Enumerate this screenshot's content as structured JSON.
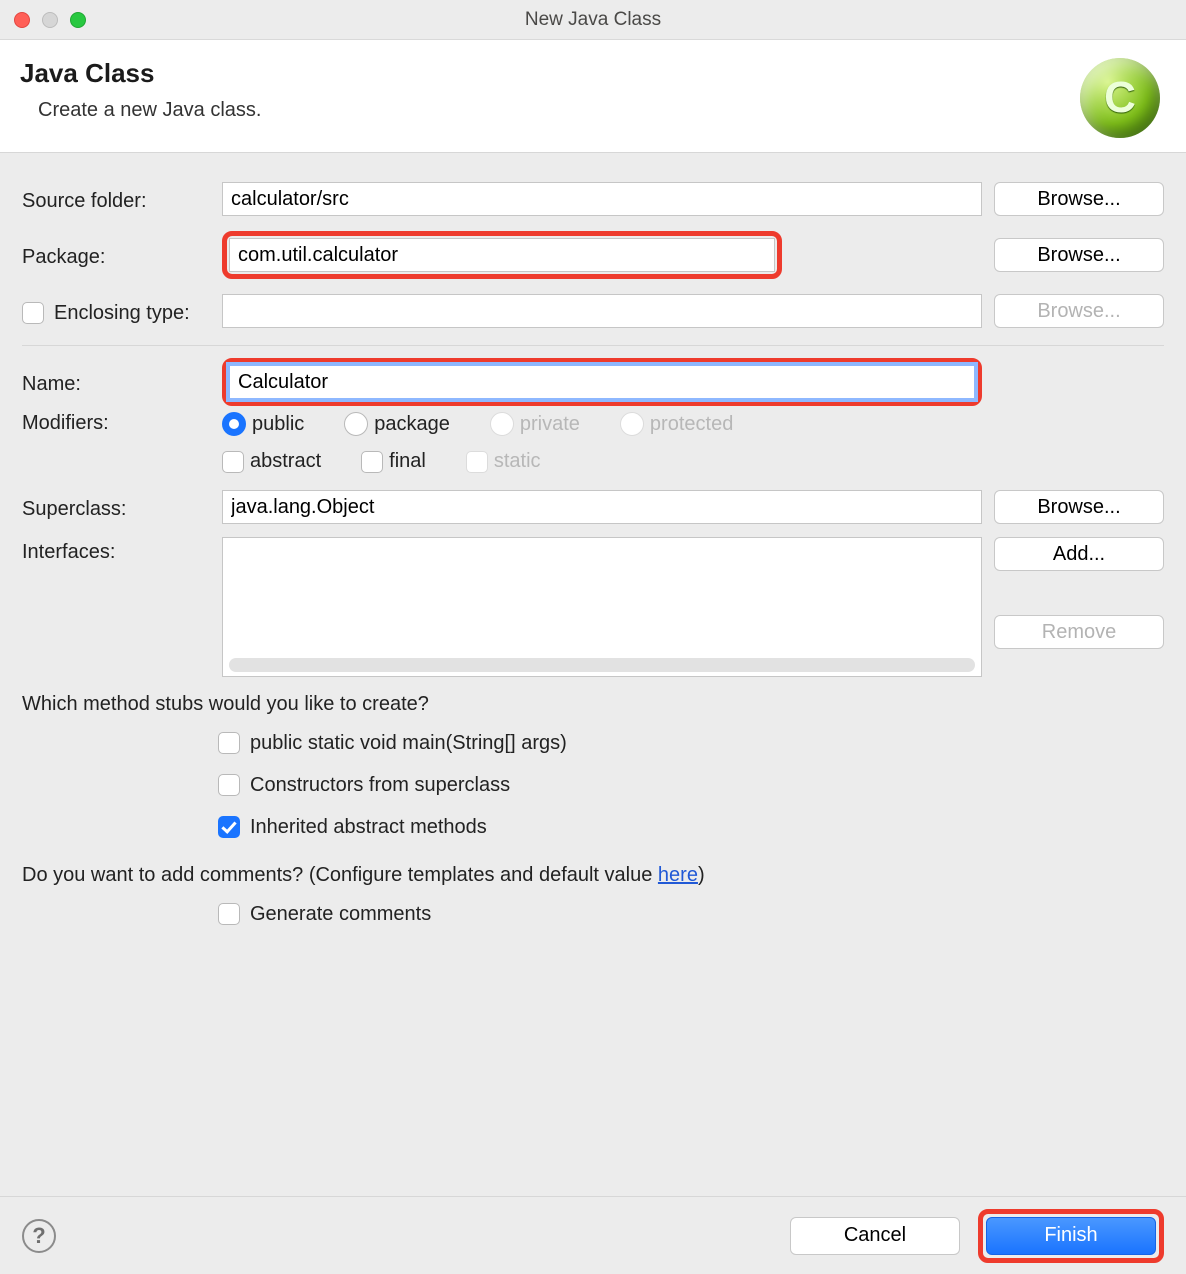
{
  "window": {
    "title": "New Java Class"
  },
  "header": {
    "heading": "Java Class",
    "subtitle": "Create a new Java class.",
    "icon_letter": "C"
  },
  "labels": {
    "source_folder": "Source folder:",
    "package": "Package:",
    "enclosing_type": "Enclosing type:",
    "name": "Name:",
    "modifiers": "Modifiers:",
    "superclass": "Superclass:",
    "interfaces": "Interfaces:"
  },
  "values": {
    "source_folder": "calculator/src",
    "package": "com.util.calculator",
    "enclosing_type": "",
    "name": "Calculator",
    "superclass": "java.lang.Object"
  },
  "buttons": {
    "browse": "Browse...",
    "add": "Add...",
    "remove": "Remove",
    "cancel": "Cancel",
    "finish": "Finish"
  },
  "modifiers": {
    "public": "public",
    "package": "package",
    "private": "private",
    "protected": "protected",
    "abstract": "abstract",
    "final": "final",
    "static": "static",
    "selected_visibility": "public"
  },
  "stubs": {
    "question": "Which method stubs would you like to create?",
    "main": "public static void main(String[] args)",
    "super_ctor": "Constructors from superclass",
    "inherited": "Inherited abstract methods"
  },
  "comments": {
    "question_pre": "Do you want to add comments? (Configure templates and default value ",
    "link": "here",
    "question_post": ")",
    "generate": "Generate comments"
  }
}
